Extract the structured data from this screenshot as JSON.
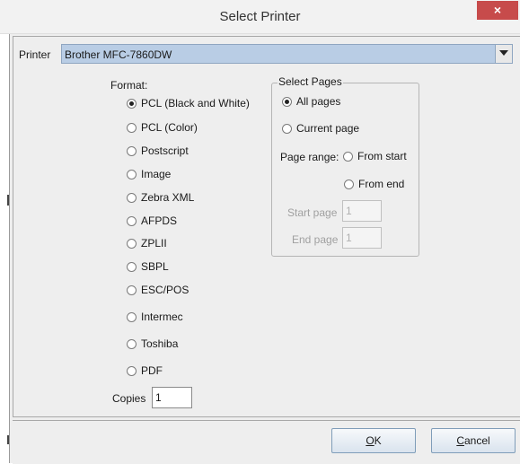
{
  "window": {
    "title": "Select Printer",
    "close_glyph": "×"
  },
  "printer": {
    "label": "Printer",
    "selected": "Brother MFC-7860DW"
  },
  "format": {
    "label": "Format:",
    "options": [
      {
        "label": "PCL (Black and White)",
        "checked": true
      },
      {
        "label": "PCL (Color)",
        "checked": false
      },
      {
        "label": "Postscript",
        "checked": false
      },
      {
        "label": "Image",
        "checked": false
      },
      {
        "label": "Zebra XML",
        "checked": false
      },
      {
        "label": "AFPDS",
        "checked": false
      },
      {
        "label": "ZPLII",
        "checked": false
      },
      {
        "label": "SBPL",
        "checked": false
      },
      {
        "label": "ESC/POS",
        "checked": false
      },
      {
        "label": "Intermec",
        "checked": false
      },
      {
        "label": "Toshiba",
        "checked": false
      },
      {
        "label": "PDF",
        "checked": false
      }
    ]
  },
  "pages": {
    "legend": "Select Pages",
    "all_pages": "All pages",
    "current_page": "Current page",
    "range_label": "Page range:",
    "from_start": "From start",
    "from_end": "From end",
    "start_label": "Start page",
    "start_value": "1",
    "end_label": "End page",
    "end_value": "1"
  },
  "copies": {
    "label": "Copies",
    "value": "1"
  },
  "buttons": {
    "ok_mnemonic": "O",
    "ok_rest": "K",
    "cancel_mnemonic": "C",
    "cancel_rest": "ancel"
  }
}
